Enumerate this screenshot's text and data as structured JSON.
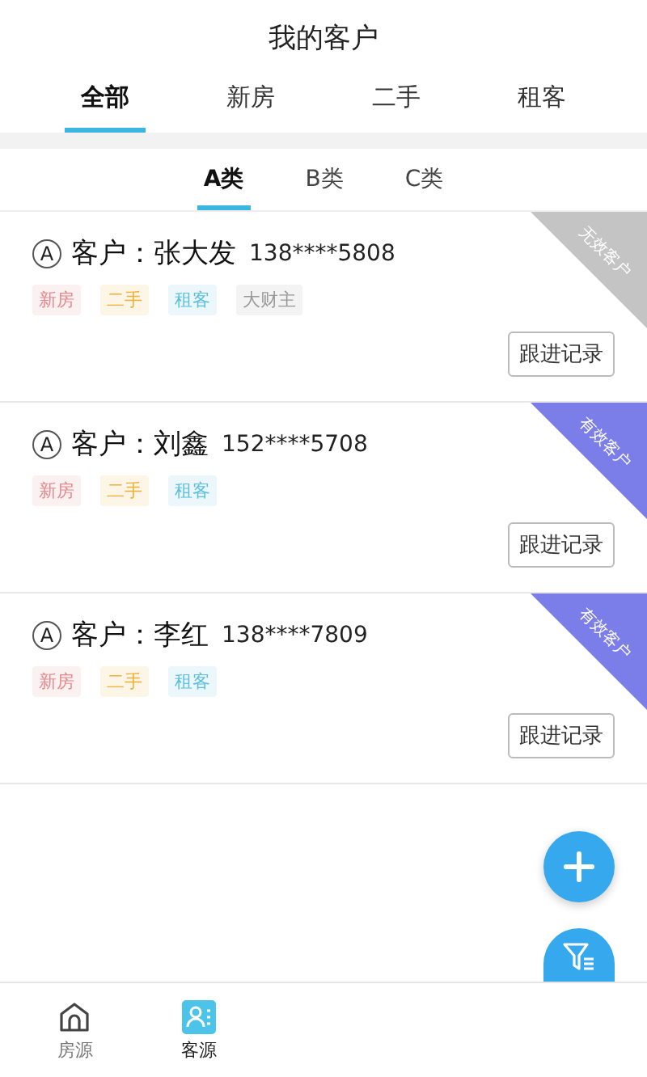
{
  "header": {
    "title": "我的客户"
  },
  "tabs": [
    {
      "label": "全部",
      "selected": true
    },
    {
      "label": "新房",
      "selected": false
    },
    {
      "label": "二手",
      "selected": false
    },
    {
      "label": "租客",
      "selected": false
    }
  ],
  "subtabs": [
    {
      "label": "A类",
      "selected": true
    },
    {
      "label": "B类",
      "selected": false
    },
    {
      "label": "C类",
      "selected": false
    }
  ],
  "customers": [
    {
      "grade": "A",
      "label": "客户：",
      "name": "张大发",
      "phone": "138****5808",
      "status": {
        "text": "无效客户",
        "kind": "invalid"
      },
      "tags": [
        {
          "text": "新房",
          "color": "#e8888c"
        },
        {
          "text": "二手",
          "color": "#f0b13a"
        },
        {
          "text": "租客",
          "color": "#5bbfe0"
        },
        {
          "text": "大财主",
          "color": "#999999"
        }
      ],
      "button": "跟进记录"
    },
    {
      "grade": "A",
      "label": "客户：",
      "name": "刘鑫",
      "phone": "152****5708",
      "status": {
        "text": "有效客户",
        "kind": "valid"
      },
      "tags": [
        {
          "text": "新房",
          "color": "#e8888c"
        },
        {
          "text": "二手",
          "color": "#f0b13a"
        },
        {
          "text": "租客",
          "color": "#5bbfe0"
        }
      ],
      "button": "跟进记录"
    },
    {
      "grade": "A",
      "label": "客户：",
      "name": "李红",
      "phone": "138****7809",
      "status": {
        "text": "有效客户",
        "kind": "valid"
      },
      "tags": [
        {
          "text": "新房",
          "color": "#e8888c"
        },
        {
          "text": "二手",
          "color": "#f0b13a"
        },
        {
          "text": "租客",
          "color": "#5bbfe0"
        }
      ],
      "button": "跟进记录"
    }
  ],
  "nav": [
    {
      "label": "房源",
      "selected": false
    },
    {
      "label": "客源",
      "selected": true
    }
  ]
}
